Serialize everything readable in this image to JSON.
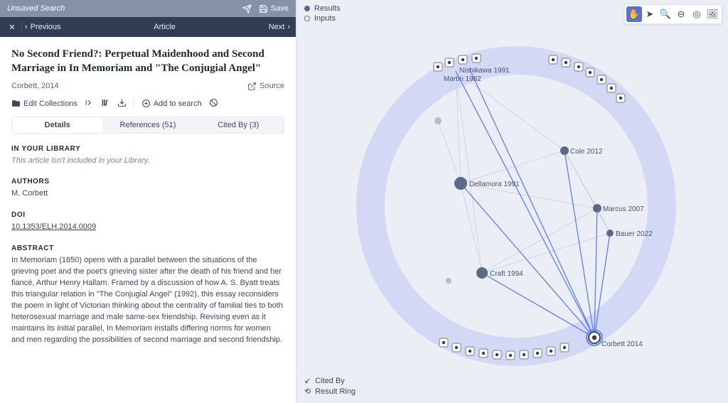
{
  "topbar": {
    "title": "Unsaved Search",
    "send": "",
    "save": "Save"
  },
  "nav": {
    "prev": "Previous",
    "title": "Article",
    "next": "Next"
  },
  "article": {
    "title": "No Second Friend?: Perpetual Maidenhood and Second Marriage in In Memoriam and \"The Conjugial Angel\"",
    "meta": "Corbett, 2014",
    "source": "Source"
  },
  "toolbar": {
    "edit": "Edit Collections",
    "add": "Add to search"
  },
  "tabs": {
    "details": "Details",
    "references_label": "References",
    "references_count": "(51)",
    "citedby_label": "Cited By",
    "citedby_count": "(3)"
  },
  "sections": {
    "library_h": "IN YOUR LIBRARY",
    "library_body": "This article isn't included in your Library.",
    "authors_h": "AUTHORS",
    "authors_body": "M. Corbett",
    "doi_h": "DOI",
    "doi_body": "10.1353/ELH.2014.0009",
    "abstract_h": "ABSTRACT",
    "abstract_body": "In Memoriam (1850) opens with a parallel between the situations of the grieving poet and the poet's grieving sister after the death of his friend and her fiancé, Arthur Henry Hallam. Framed by a discussion of how A. S. Byatt treats this triangular relation in \"The Conjugial Angel\" (1992), this essay reconsiders the poem in light of Victorian thinking about the centrality of familial ties to both heterosexual marriage and male same-sex friendship. Revising even as it maintains its initial parallel, In Memoriam installs differing norms for women and men regarding the possibilities of second marriage and second friendship."
  },
  "legend_top": {
    "results": "Results",
    "inputs": "Inputs"
  },
  "legend_bot": {
    "citedby": "Cited By",
    "ring": "Result Ring"
  },
  "graph": {
    "labels": {
      "n1": "Nishikawa 1991",
      "n2": "Martin 1982",
      "n3": "Cole 2012",
      "n4": "Dellamora 1991",
      "n5": "Marcus 2007",
      "n6": "Bauer 2022",
      "n7": "Craft 1994",
      "focus": "Corbett 2014"
    }
  }
}
